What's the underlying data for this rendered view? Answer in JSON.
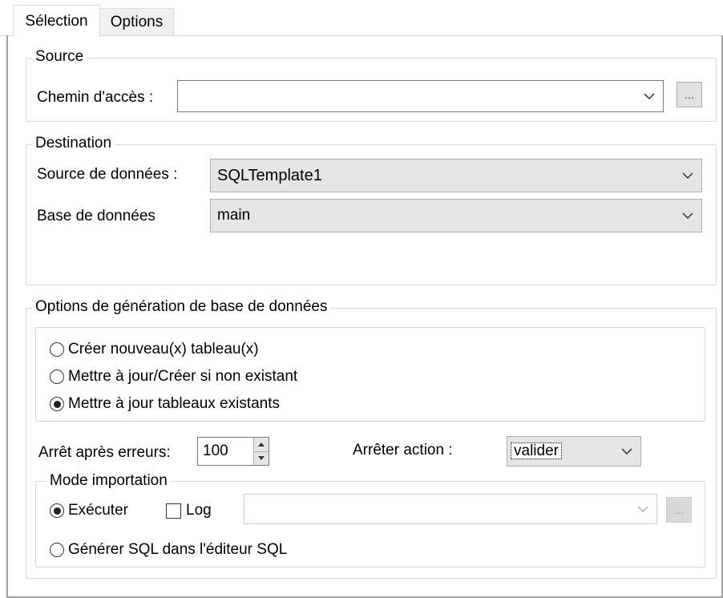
{
  "tabs": [
    {
      "label": "Sélection",
      "active": true
    },
    {
      "label": "Options",
      "active": false
    }
  ],
  "source": {
    "legend": "Source",
    "path_label": "Chemin d'accès :",
    "path_value": "",
    "browse_label": "..."
  },
  "destination": {
    "legend": "Destination",
    "datasource_label": "Source de données :",
    "datasource_value": "SQLTemplate1",
    "database_label": "Base de données",
    "database_value": "main"
  },
  "generation": {
    "legend": "Options de génération de base de données",
    "options": [
      {
        "label": "Créer nouveau(x) tableau(x)",
        "selected": false
      },
      {
        "label": "Mettre à jour/Créer si non existant",
        "selected": false
      },
      {
        "label": "Mettre à jour tableaux existants",
        "selected": true
      }
    ],
    "stop_after_errors_label": "Arrêt après erreurs:",
    "stop_after_errors_value": "100",
    "stop_action_label": "Arrêter action :",
    "stop_action_value": "valider"
  },
  "import_mode": {
    "legend": "Mode importation",
    "execute_label": "Exécuter",
    "execute_selected": true,
    "log_label": "Log",
    "log_checked": false,
    "log_path_value": "",
    "log_browse_label": "...",
    "generate_sql_label": "Générer SQL dans l'éditeur SQL",
    "generate_sql_selected": false
  },
  "colors": {
    "group_border": "#d5d5d5",
    "combo_gray": "#e5e5e5",
    "button_face": "#e1e1e1"
  }
}
